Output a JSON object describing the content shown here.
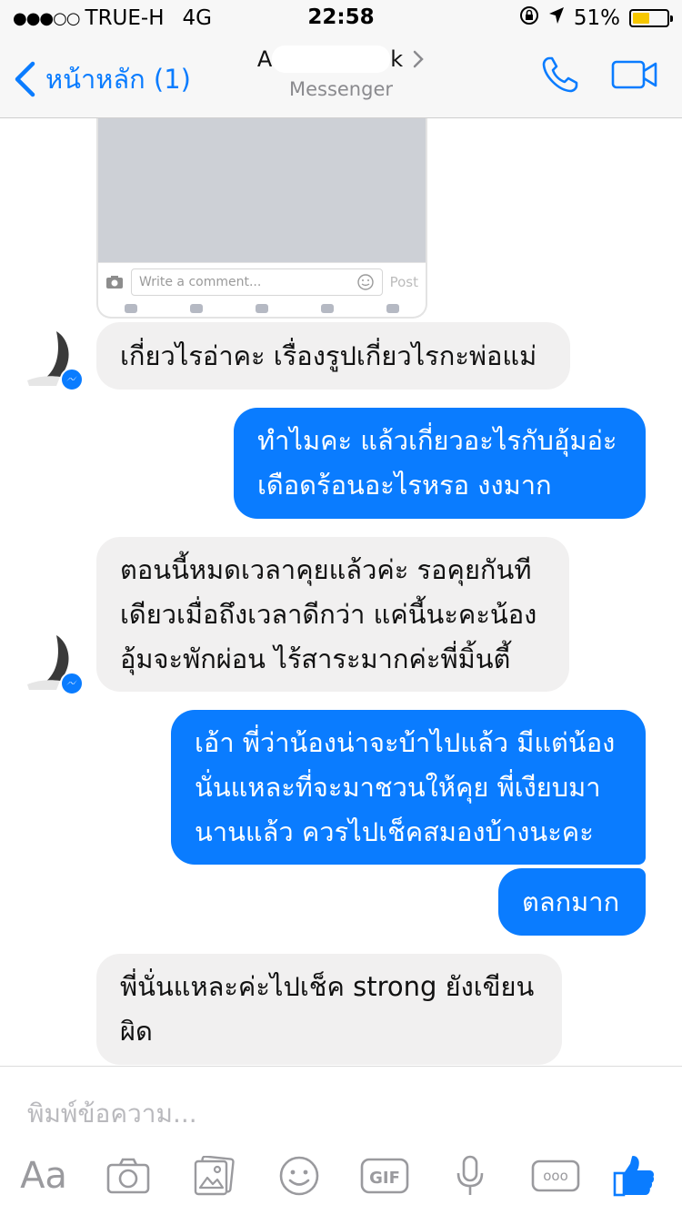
{
  "status_bar": {
    "signal": "●●●○○",
    "carrier": "TRUE-H",
    "network": "4G",
    "time": "22:58",
    "battery": "51%",
    "battery_fraction": 0.51,
    "battery_color": "#f6c700"
  },
  "nav": {
    "back_label": "หน้าหลัก (1)",
    "title_visible": "A",
    "title_tail": "k",
    "subtitle": "Messenger"
  },
  "shared_post": {
    "comment_placeholder": "Write a comment...",
    "post_label": "Post"
  },
  "messages": [
    {
      "side": "in",
      "text": "เกี่ยวไรอ่าคะ เรื่องรูปเกี่ยวไรกะพ่อแม่"
    },
    {
      "side": "out",
      "text": "ทำไมคะ แล้วเกี่ยวอะไรกับอุ้มอ่ะ\nเดือดร้อนอะไรหรอ งงมาก"
    },
    {
      "side": "in",
      "text": "ตอนนี้หมดเวลาคุยแล้วค่ะ รอคุยกันที\nเดียวเมื่อถึงเวลาดีกว่า แค่นี้นะคะน้อง\nอุ้มจะพักผ่อน ไร้สาระมากค่ะพี่มิ้นตี้"
    },
    {
      "side": "out",
      "text": "เอ้า พี่ว่าน้องน่าจะบ้าไปแล้ว มีแต่น้อง\nนั่นแหละที่จะมาชวนให้คุย พี่เงียบมา\nนานแล้ว ควรไปเช็คสมองบ้างนะคะ"
    },
    {
      "side": "out",
      "text": "ตลกมาก"
    },
    {
      "side": "in",
      "text": "พี่นั่นแหละค่ะไปเช็ค strong ยังเขียน\nผิด"
    }
  ],
  "composer": {
    "placeholder": "พิมพ์ข้อความ...",
    "aa_label": "Aa",
    "gif_label": "GIF",
    "more_label": "ooo"
  },
  "colors": {
    "accent": "#0a7cff",
    "incoming_bubble": "#f1f0f0",
    "outgoing_bubble": "#0a7cff"
  },
  "icons": [
    "location-lock-icon",
    "location-arrow-icon",
    "phone-icon",
    "video-camera-icon",
    "camera-icon",
    "image-icon",
    "smiley-icon",
    "gif-icon",
    "microphone-icon",
    "more-icon",
    "thumbs-up-icon",
    "messenger-badge-icon"
  ]
}
